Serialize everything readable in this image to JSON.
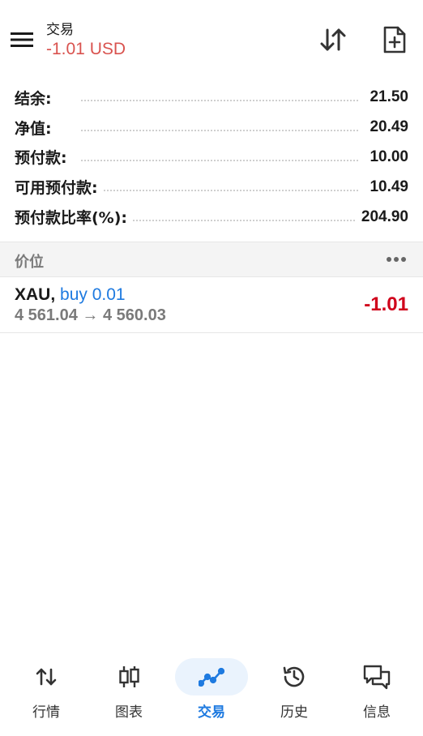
{
  "header": {
    "title": "交易",
    "subtitle": "-1.01 USD",
    "icons": [
      "menu-icon",
      "sort-icon",
      "new-order-icon"
    ]
  },
  "summary": [
    {
      "label": "结余:",
      "value": "21.50"
    },
    {
      "label": "净值:",
      "value": "20.49"
    },
    {
      "label": "预付款:",
      "value": "10.00"
    },
    {
      "label": "可用预付款:",
      "value": "10.49"
    },
    {
      "label": "预付款比率(%):",
      "value": "204.90"
    }
  ],
  "positions_section": {
    "title": "价位",
    "more_icon": "more-horizontal-icon"
  },
  "positions": [
    {
      "symbol": "XAU,",
      "trade": "buy 0.01",
      "prices": "4 561.04 → 4 560.03",
      "profit": "-1.01"
    }
  ],
  "nav": [
    {
      "label": "行情",
      "icon": "quotes-arrows-icon",
      "active": false
    },
    {
      "label": "图表",
      "icon": "candlestick-chart-icon",
      "active": false
    },
    {
      "label": "交易",
      "icon": "trade-line-icon",
      "active": true
    },
    {
      "label": "历史",
      "icon": "history-clock-icon",
      "active": false
    },
    {
      "label": "信息",
      "icon": "messages-icon",
      "active": false
    }
  ],
  "colors": {
    "accent": "#1e7ae0",
    "loss": "#d0021b",
    "subtitle_loss": "#d9534f",
    "section_bg": "#f4f4f4"
  }
}
